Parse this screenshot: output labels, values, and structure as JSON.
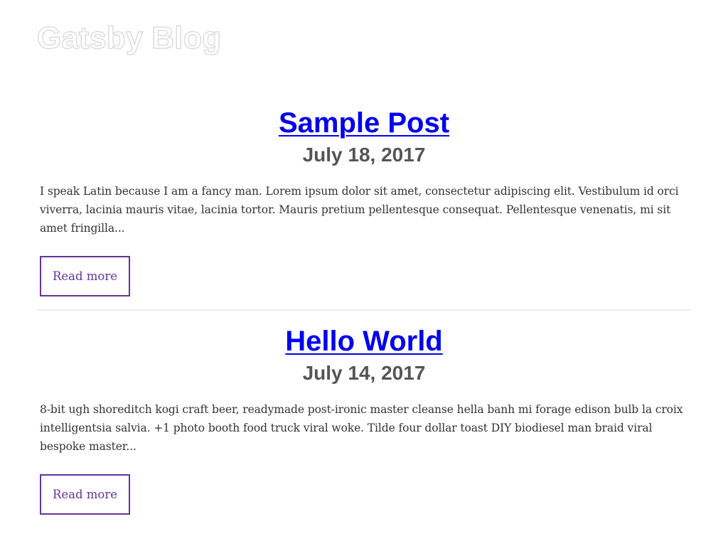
{
  "header": {
    "site_title": "Gatsby Blog"
  },
  "posts": [
    {
      "title": "Sample Post",
      "date": "July 18, 2017",
      "excerpt": "I speak Latin because I am a fancy man. Lorem ipsum dolor sit amet, consectetur adipiscing elit. Vestibulum id orci viverra, lacinia mauris vitae, lacinia tortor. Mauris pretium pellentesque consequat. Pellentesque venenatis, mi sit amet fringilla...",
      "read_more_label": "Read more"
    },
    {
      "title": "Hello World",
      "date": "July 14, 2017",
      "excerpt": "8-bit ugh shoreditch kogi craft beer, readymade post-ironic master cleanse hella banh mi forage edison bulb la croix intelligentsia salvia. +1 photo booth food truck viral woke. Tilde four dollar toast DIY biodiesel man braid viral bespoke master...",
      "read_more_label": "Read more"
    }
  ],
  "colors": {
    "link": "#0000ee",
    "accent": "#663399",
    "date": "#555555",
    "divider": "#ececec"
  }
}
